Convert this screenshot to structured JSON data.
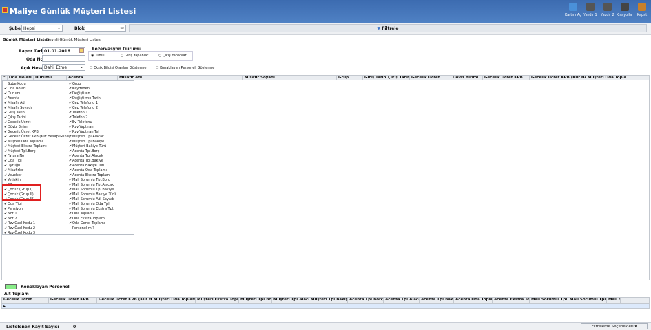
{
  "window": {
    "title": "Maliye Günlük Müşteri Listesi"
  },
  "toolbar": {
    "buttons": [
      {
        "label": "Kartını Aç",
        "icon": "users-icon"
      },
      {
        "label": "Yazdır 1",
        "icon": "printer-icon"
      },
      {
        "label": "Yazdır 2",
        "icon": "printer-icon"
      },
      {
        "label": "Kısayollar",
        "icon": "shortcut-icon"
      },
      {
        "label": "Kapat",
        "icon": "exit-icon"
      }
    ]
  },
  "filters": {
    "sube_label": "Şube",
    "sube_value": "Hepsi",
    "blok_label": "Blok",
    "blok_value": "",
    "filter_button": "Filtrele"
  },
  "tabs": [
    "Günlük Müşteri Listesi",
    "Devirli Günlük Müşteri Listesi"
  ],
  "panel": {
    "rapor_tarihi_label": "Rapor Tarihi",
    "rapor_tarihi_value": "01.01.2016",
    "oda_no_label": "Oda No",
    "oda_no_value": "",
    "acik_hesap_label": "Açık Hesap",
    "acik_hesap_value": "Dahil Etme",
    "rezervasyon_title": "Rezervasyon Durumu",
    "radios": [
      "Tümü",
      "Giriş Yapanlar",
      "Çıkış Yapanlar"
    ],
    "checkbox1": "Eksik Bilgisi Olanları Gösterme",
    "checkbox2": "Konaklayan Personeli Gösterme"
  },
  "grid_columns": [
    "Oda Noları",
    "Durumu",
    "Acenta",
    "Misafir Adı",
    "Misafir Soyadı",
    "Grup",
    "Giriş Tarihi",
    "Çıkış Tarihi",
    "Gecelik Ücret",
    "Döviz Birimi",
    "Gecelik Ücret KPB",
    "Gecelik Ücret KPB (Kur He...",
    "Müşteri Oda Toplam"
  ],
  "popup_col1": [
    {
      "t": "Şube Kodu",
      "c": false
    },
    {
      "t": "Oda Noları",
      "c": true
    },
    {
      "t": "Durumu",
      "c": true
    },
    {
      "t": "Acenta",
      "c": true
    },
    {
      "t": "Misafir Adı",
      "c": true
    },
    {
      "t": "Misafir Soyadı",
      "c": true
    },
    {
      "t": "Giriş Tarihi",
      "c": true
    },
    {
      "t": "Çıkış Tarihi",
      "c": true
    },
    {
      "t": "Gecelik Ücret",
      "c": true
    },
    {
      "t": "Döviz Birimi",
      "c": true
    },
    {
      "t": "Gecelik Ücret KPB",
      "c": true
    },
    {
      "t": "Gecelik Ücret KPB (Kur Hesap Günü)",
      "c": true
    },
    {
      "t": "Müşteri Oda Toplamı",
      "c": true
    },
    {
      "t": "Müşteri Ekstra Toplamı",
      "c": true
    },
    {
      "t": "Müşteri Tpl.Borç",
      "c": true
    },
    {
      "t": "Fatura No",
      "c": true
    },
    {
      "t": "Oda Tipi",
      "c": true
    },
    {
      "t": "Uyruğu",
      "c": true
    },
    {
      "t": "Misafirler",
      "c": true
    },
    {
      "t": "Voucher",
      "c": true
    },
    {
      "t": "Yetişkin",
      "c": true
    },
    {
      "t": "EB",
      "c": true
    },
    {
      "t": "Çocuk (Grup I)",
      "c": true
    },
    {
      "t": "Çocuk (Grup II)",
      "c": true
    },
    {
      "t": "Çocuk (Grup III)",
      "c": true
    },
    {
      "t": "Oda Tipi",
      "c": true
    },
    {
      "t": "Pansiyon",
      "c": true
    },
    {
      "t": "Not 1",
      "c": true
    },
    {
      "t": "Not 2",
      "c": true
    },
    {
      "t": "Rzv.Özel Kodu 1",
      "c": true
    },
    {
      "t": "Rzv.Özel Kodu 2",
      "c": true
    },
    {
      "t": "Rzv.Özel Kodu 3",
      "c": true
    }
  ],
  "popup_col2": [
    {
      "t": "Grup",
      "c": true
    },
    {
      "t": "Kaydeden",
      "c": true
    },
    {
      "t": "Değiştiren",
      "c": true
    },
    {
      "t": "Değiştirme Tarihi",
      "c": true
    },
    {
      "t": "Cep Telefonu 1",
      "c": true
    },
    {
      "t": "Cep Telefonu 2",
      "c": true
    },
    {
      "t": "Telefon 1",
      "c": true
    },
    {
      "t": "Telefon 2",
      "c": true
    },
    {
      "t": "Ev Telefonu",
      "c": true
    },
    {
      "t": "Rzv.Yaptıran",
      "c": true
    },
    {
      "t": "Rzv.Yaptıran Tel",
      "c": true
    },
    {
      "t": "Müşteri Tpl.Alacak",
      "c": true
    },
    {
      "t": "Müşteri Tpl.Bakiye",
      "c": true
    },
    {
      "t": "Müşteri Bakiye Türü",
      "c": true
    },
    {
      "t": "Acenta Tpl.Borç",
      "c": true
    },
    {
      "t": "Acenta Tpl.Alacak",
      "c": true
    },
    {
      "t": "Acenta Tpl.Bakiye",
      "c": true
    },
    {
      "t": "Acenta Bakiye Türü",
      "c": true
    },
    {
      "t": "Acenta Oda Toplamı",
      "c": true
    },
    {
      "t": "Acenta Ekstra Toplamı",
      "c": true
    },
    {
      "t": "Mali Sorumlu Tpl.Borç",
      "c": true
    },
    {
      "t": "Mali Sorumlu Tpl.Alacak",
      "c": true
    },
    {
      "t": "Mali Sorumlu Tpl.Bakiye",
      "c": true
    },
    {
      "t": "Mali Sorumlu Bakiye Türü",
      "c": true
    },
    {
      "t": "Mali Sorumlu Adı Soyadı",
      "c": true
    },
    {
      "t": "Mali Sorumlu Oda Tpl.",
      "c": true
    },
    {
      "t": "Mali Sorumlu Ekstra Tpl.",
      "c": true
    },
    {
      "t": "Oda Toplamı",
      "c": true
    },
    {
      "t": "Oda Ekstra Toplamı",
      "c": true
    },
    {
      "t": "Oda Genel Toplamı",
      "c": true
    },
    {
      "t": "Personel mi?",
      "c": false
    }
  ],
  "legend": {
    "label": "Konaklayan Personel",
    "color": "#88ec88"
  },
  "subtotal": {
    "title": "Alt Toplam",
    "columns": [
      "Gecelik Ücret",
      "Gecelik Ücret KPB",
      "Gecelik Ücret KPB (Kur He...",
      "Müşteri Oda Toplamı",
      "Müşteri Ekstra Toplamı",
      "Müşteri Tpl.Borç",
      "Müşteri Tpl.Alacak",
      "Müşteri Tpl.Bakiye",
      "Acenta Tpl.Borç",
      "Acenta Tpl.Alacak",
      "Acenta Tpl.Bakiye",
      "Acenta Oda Toplamı",
      "Acenta Ekstra Toplamı",
      "Mali Sorumlu Tpl.Borç",
      "Mali Sorumlu Tpl.Alacak",
      "Mali Sor"
    ]
  },
  "status": {
    "count_label": "Listelenen Kayıt Sayısı",
    "count_value": "0",
    "filter_options": "Filtreleme Seçenekleri"
  }
}
